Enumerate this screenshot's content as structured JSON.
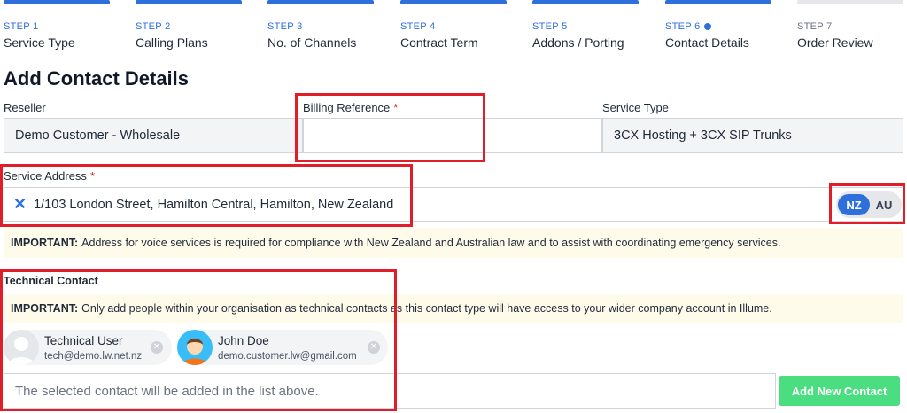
{
  "steps": [
    {
      "num": "STEP 1",
      "name": "Service Type",
      "state": "done"
    },
    {
      "num": "STEP 2",
      "name": "Calling Plans",
      "state": "done"
    },
    {
      "num": "STEP 3",
      "name": "No. of Channels",
      "state": "done"
    },
    {
      "num": "STEP 4",
      "name": "Contract Term",
      "state": "done"
    },
    {
      "num": "STEP 5",
      "name": "Addons / Porting",
      "state": "done"
    },
    {
      "num": "STEP 6",
      "name": "Contact Details",
      "state": "current"
    },
    {
      "num": "STEP 7",
      "name": "Order Review",
      "state": "pending"
    }
  ],
  "page_title": "Add Contact Details",
  "reseller": {
    "label": "Reseller",
    "value": "Demo Customer - Wholesale"
  },
  "billing_reference": {
    "label": "Billing Reference",
    "required_mark": "*",
    "value": ""
  },
  "service_type": {
    "label": "Service Type",
    "value": "3CX Hosting + 3CX SIP Trunks"
  },
  "service_address": {
    "label": "Service Address",
    "required_mark": "*",
    "clear_glyph": "✕",
    "value": "1/103 London Street, Hamilton Central, Hamilton, New Zealand",
    "country_toggle": {
      "options": [
        "NZ",
        "AU"
      ],
      "selected": "NZ"
    }
  },
  "address_notice": {
    "bold": "IMPORTANT:",
    "text": "Address for voice services is required for compliance with New Zealand and Australian law and to assist with coordinating emergency services."
  },
  "technical_contact": {
    "label": "Technical Contact",
    "notice_bold": "IMPORTANT:",
    "notice_text": "Only add people within your organisation as technical contacts as this contact type will have access to your wider company account in Illume.",
    "contacts": [
      {
        "name": "Technical User",
        "email": "tech@demo.lw.net.nz",
        "avatar": "default-user-avatar"
      },
      {
        "name": "John Doe",
        "email": "demo.customer.lw@gmail.com",
        "avatar": "cartoon-person-avatar"
      }
    ],
    "remove_glyph": "✕",
    "input_placeholder": "The selected contact will be added in the list above.",
    "add_button": "Add New Contact"
  },
  "colors": {
    "primary": "#2f6fdb",
    "success": "#4ade80",
    "annotation_red": "#e11d2a",
    "notice_bg": "#fffbeb"
  }
}
